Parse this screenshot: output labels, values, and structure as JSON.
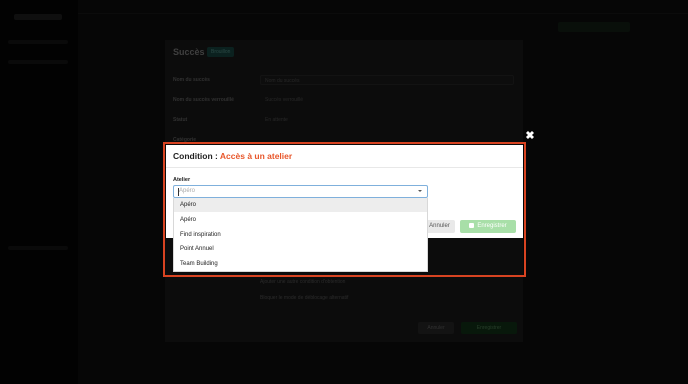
{
  "background_modal": {
    "title": "Succès :",
    "badge": "Brouillon",
    "fields": [
      {
        "label": "Nom du succès",
        "value": "Nom du succès"
      },
      {
        "label": "Nom du succès verrouillé",
        "value": "Succès verrouillé"
      },
      {
        "label": "Statut",
        "value": "En attente"
      },
      {
        "label": "Catégorie",
        "value": ""
      }
    ],
    "checks": [
      "Ajouter une autre condition d'obtention",
      "Bloquer le mode de déblocage alternatif"
    ],
    "cancel_label": "Annuler",
    "save_label": "Enregistrer"
  },
  "condition_modal": {
    "title_prefix": "Condition :",
    "title_accent": "Accès à un atelier",
    "field_label": "Atelier",
    "select_value": "Apéro",
    "options": [
      "Apéro",
      "Apéro",
      "Find inspiration",
      "Point Annuel",
      "Team Building"
    ],
    "cancel_label": "Annuler",
    "save_label": "Enregistrer"
  },
  "colors": {
    "accent": "#e8562a",
    "highlight_border": "#d84321",
    "save_button": "#a8dfa8"
  },
  "icons": {
    "close": "close-icon",
    "dropdown": "chevron-down-icon",
    "save": "save-icon"
  }
}
